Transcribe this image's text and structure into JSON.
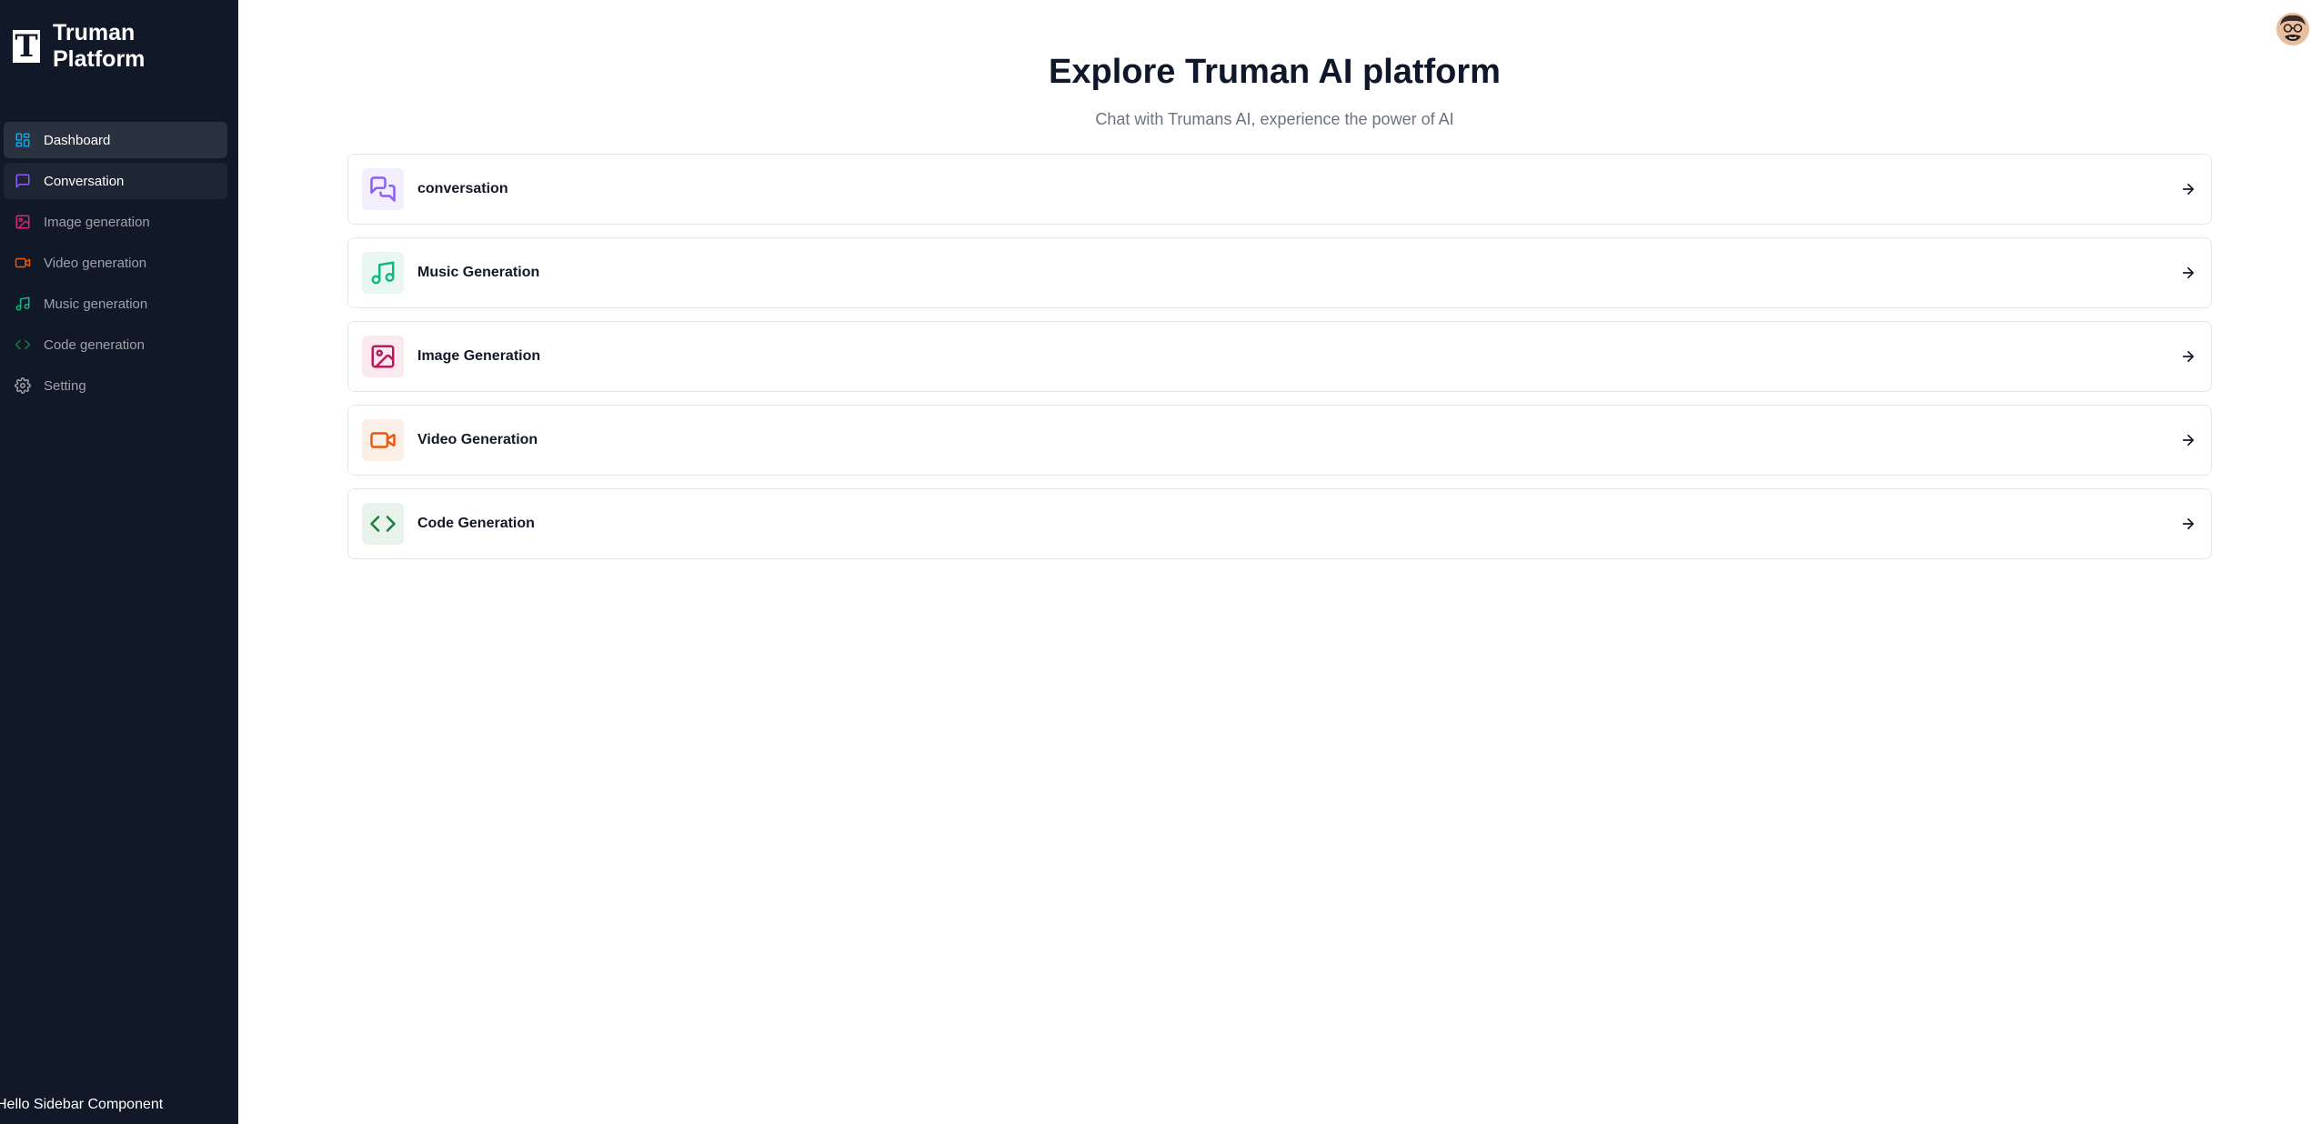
{
  "brand": {
    "logo_letter": "T",
    "name": "Truman Platform"
  },
  "sidebar": {
    "items": [
      {
        "label": "Dashboard",
        "icon": "dashboard-icon",
        "color": "#0ea5e9",
        "state": "active"
      },
      {
        "label": "Conversation",
        "icon": "message-square-icon",
        "color": "#8b5cf6",
        "state": "hover"
      },
      {
        "label": "Image generation",
        "icon": "image-icon",
        "color": "#db2777",
        "state": ""
      },
      {
        "label": "Video generation",
        "icon": "video-icon",
        "color": "#ea580c",
        "state": ""
      },
      {
        "label": "Music generation",
        "icon": "music-icon",
        "color": "#10b981",
        "state": ""
      },
      {
        "label": "Code generation",
        "icon": "code-icon",
        "color": "#15803d",
        "state": ""
      },
      {
        "label": "Setting",
        "icon": "settings-icon",
        "color": "#a1a1aa",
        "state": ""
      }
    ],
    "footer": "Hello Sidebar Component"
  },
  "header": {
    "avatar": "user-avatar"
  },
  "main": {
    "title": "Explore Truman AI platform",
    "subtitle": "Chat with Trumans AI, experience the power of AI",
    "cards": [
      {
        "label": "conversation",
        "icon": "messages-icon",
        "color": "#8b5cf6",
        "bg": "#f3eefe"
      },
      {
        "label": "Music Generation",
        "icon": "music-icon",
        "color": "#10b981",
        "bg": "#e8f7f1"
      },
      {
        "label": "Image Generation",
        "icon": "image-icon",
        "color": "#be185d",
        "bg": "#fbe9f0"
      },
      {
        "label": "Video Generation",
        "icon": "video-icon",
        "color": "#ea580c",
        "bg": "#fcefe8"
      },
      {
        "label": "Code Generation",
        "icon": "code-icon",
        "color": "#15803d",
        "bg": "#e7f3eb"
      }
    ]
  }
}
